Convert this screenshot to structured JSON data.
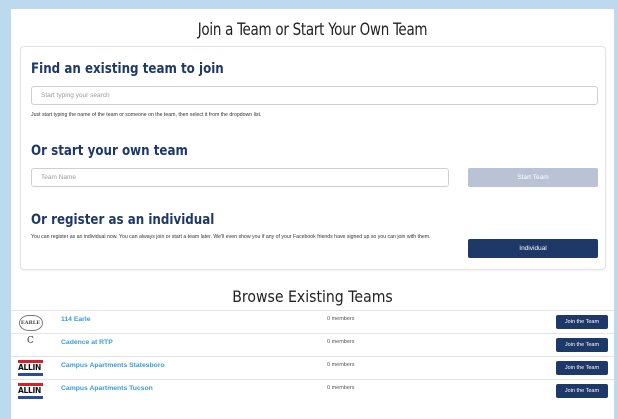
{
  "header": {
    "title": "Join a Team or Start Your Own Team"
  },
  "find": {
    "heading": "Find an existing team to join",
    "search_placeholder": "Start typing your search",
    "hint": "Just start typing the name of the team or someone on the team, then select it from the dropdown list."
  },
  "start": {
    "heading": "Or start your own team",
    "team_name_placeholder": "Team Name",
    "button_label": "Start Team"
  },
  "individual": {
    "heading": "Or register as an individual",
    "description": "You can register as an individual now. You can always join or start a team later. We'll even show you if any of your Facebook friends have signed up so you can join with them.",
    "button_label": "Individual"
  },
  "browse": {
    "title": "Browse Existing Teams",
    "teams": [
      {
        "name": "114 Earle",
        "members": "0 members",
        "join_label": "Join the Team",
        "logo": "earle-logo",
        "logo_text": "EARLE"
      },
      {
        "name": "Cadence at RTP",
        "members": "0 members",
        "join_label": "Join the Team",
        "logo": "cadence-logo",
        "logo_text": "C"
      },
      {
        "name": "Campus Apartments Statesboro",
        "members": "0 members",
        "join_label": "Join the Team",
        "logo": "allin-logo",
        "logo_text": "ALLIN"
      },
      {
        "name": "Campus Apartments Tucson",
        "members": "0 members",
        "join_label": "Join the Team",
        "logo": "allin-logo",
        "logo_text": "ALLIN"
      }
    ]
  },
  "colors": {
    "background": "#bcd9ee",
    "heading": "#1e3868",
    "primary_button": "#1e3868",
    "disabled_button": "#b9c3d3",
    "team_link": "#3a9bd8"
  }
}
